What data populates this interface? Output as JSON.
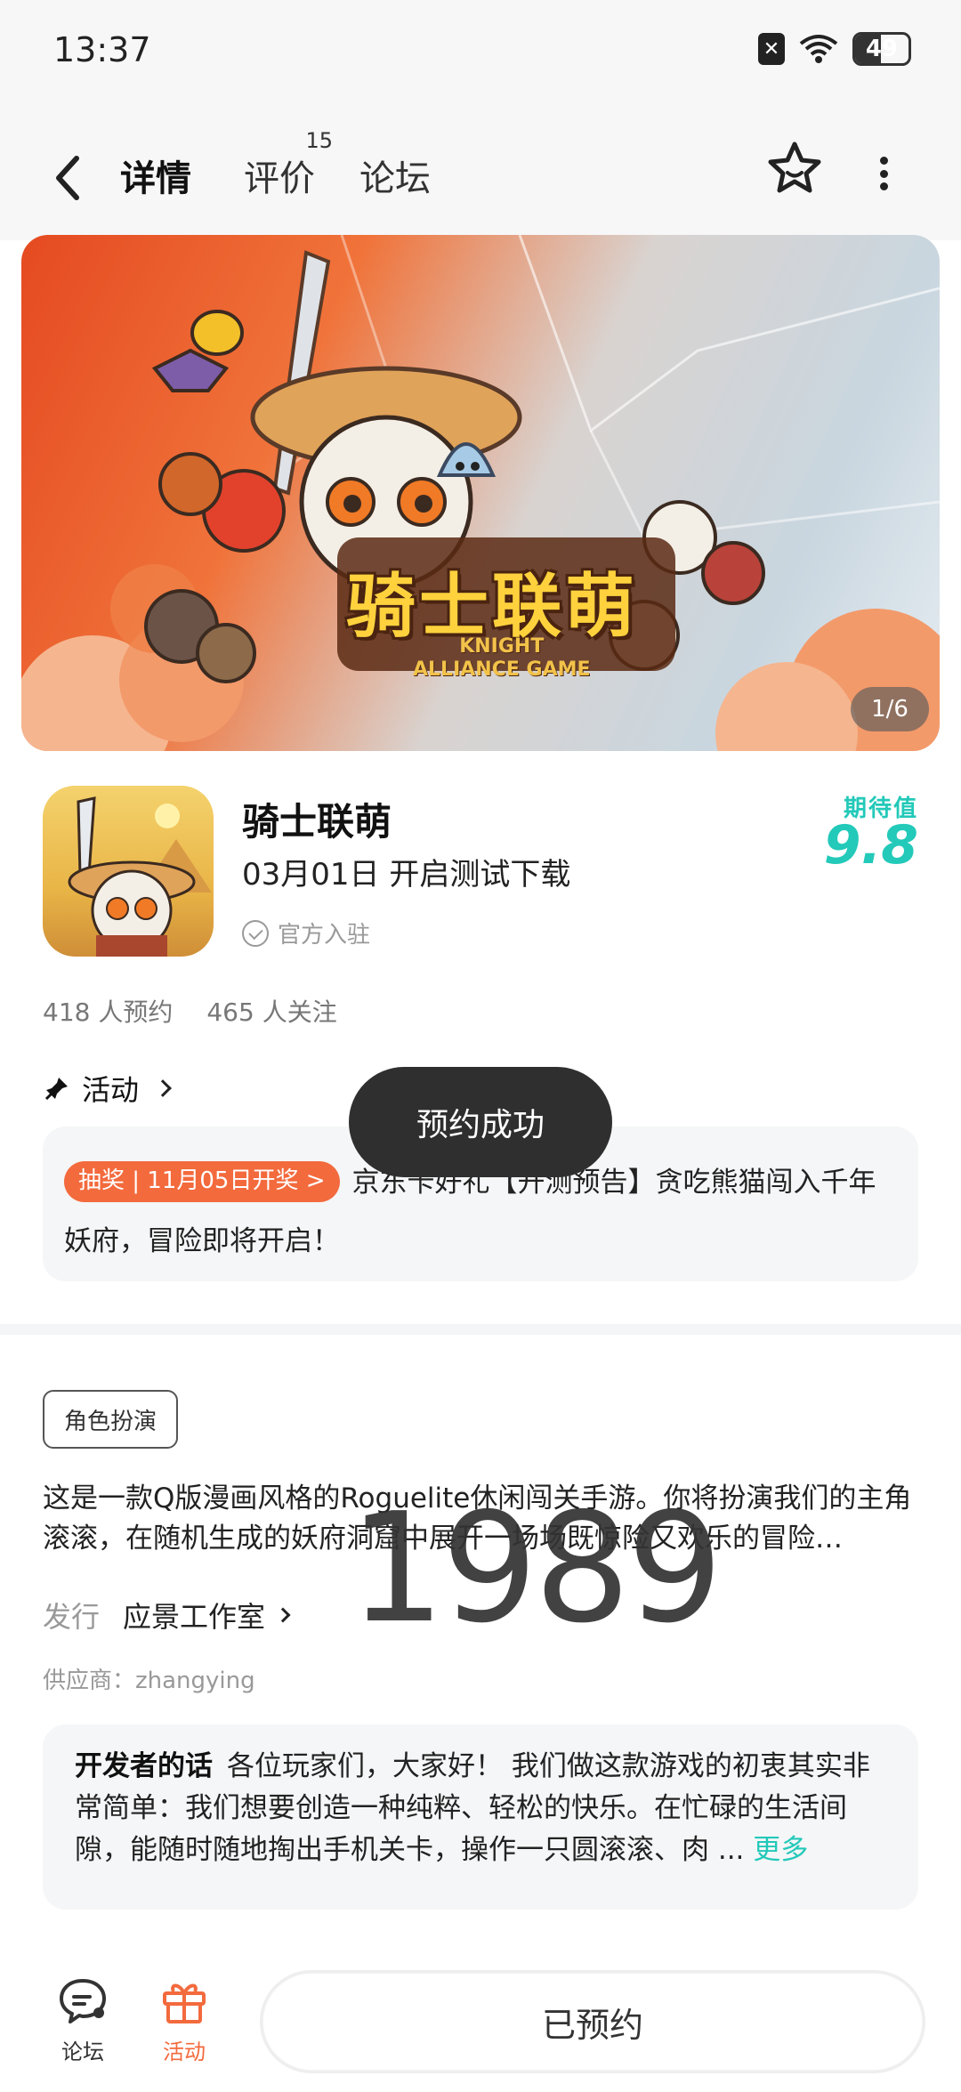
{
  "status_bar": {
    "time": "13:37",
    "battery": "49"
  },
  "header": {
    "tabs": [
      {
        "label": "详情",
        "active": true
      },
      {
        "label": "评价",
        "count": "15"
      },
      {
        "label": "论坛"
      }
    ]
  },
  "banner": {
    "logo_text": "骑士联萌",
    "logo_subtitle_1": "KNIGHT",
    "logo_subtitle_2": "ALLIANCE GAME",
    "counter": "1/6"
  },
  "app": {
    "title": "骑士联萌",
    "date_text": "03月01日 开启测试下载",
    "official": "官方入驻",
    "expect_label": "期待值",
    "expect_value": "9.8",
    "reservations": "418 人预约",
    "followers": "465 人关注"
  },
  "activity": {
    "heading": "活动",
    "tag": "抽奖 | 11月05日开奖 >",
    "text": "京东卡好礼【开测预告】贪吃熊猫闯入千年妖府，冒险即将开启！"
  },
  "toast": "预约成功",
  "details": {
    "genre": "角色扮演",
    "description": "这是一款Q版漫画风格的Roguelite休闲闯关手游。你将扮演我们的主角滚滚，在随机生成的妖府洞窟中展开一场场既惊险又欢乐的冒险…",
    "publisher_label": "发行",
    "publisher_value": "应景工作室",
    "supplier": "供应商：zhangying",
    "watermark": "1989"
  },
  "developer_note": {
    "label": "开发者的话",
    "text": "各位玩家们，大家好！ 我们做这款游戏的初衷其实非常简单：我们想要创造一种纯粹、轻松的快乐。在忙碌的生活间隙，能随时随地掏出手机关卡，操作一只圆滚滚、肉 ... ",
    "more": "更多"
  },
  "bottom_bar": {
    "forum_label": "论坛",
    "activity_label": "活动",
    "reserved_label": "已预约"
  },
  "colors": {
    "accent": "#23c9b9",
    "orange": "#f36a3d"
  }
}
